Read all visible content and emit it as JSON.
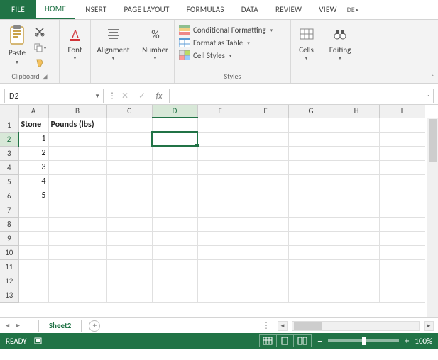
{
  "tabs": {
    "file": "FILE",
    "home": "HOME",
    "insert": "INSERT",
    "pageLayout": "PAGE LAYOUT",
    "formulas": "FORMULAS",
    "data": "DATA",
    "review": "REVIEW",
    "view": "VIEW",
    "more": "DE"
  },
  "ribbon": {
    "paste": "Paste",
    "clipboard": "Clipboard",
    "font": "Font",
    "alignment": "Alignment",
    "number": "Number",
    "styles": "Styles",
    "condFmt": "Conditional Formatting",
    "fmtTable": "Format as Table",
    "cellStyles": "Cell Styles",
    "cells": "Cells",
    "editing": "Editing"
  },
  "namebox": "D2",
  "sheet": {
    "name": "Sheet2"
  },
  "cols": [
    "A",
    "B",
    "C",
    "D",
    "E",
    "F",
    "G",
    "H",
    "I"
  ],
  "rows": [
    "1",
    "2",
    "3",
    "4",
    "5",
    "6",
    "7",
    "8",
    "9",
    "10",
    "11",
    "12",
    "13"
  ],
  "dataCells": {
    "A1": "Stone",
    "B1": "Pounds (lbs)",
    "A2": "1",
    "A3": "2",
    "A4": "3",
    "A5": "4",
    "A6": "5"
  },
  "status": {
    "ready": "READY",
    "zoom": "100%"
  }
}
